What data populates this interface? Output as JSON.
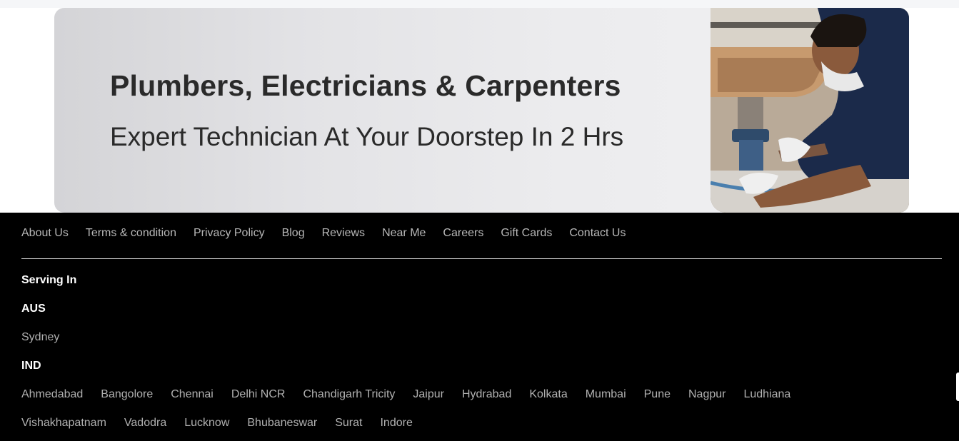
{
  "banner": {
    "title": "Plumbers, Electricians & Carpenters",
    "subtitle": "Expert Technician At Your Doorstep In 2 Hrs"
  },
  "footer": {
    "links": [
      "About Us",
      "Terms & condition",
      "Privacy Policy",
      "Blog",
      "Reviews",
      "Near Me",
      "Careers",
      "Gift Cards",
      "Contact Us"
    ],
    "serving_heading": "Serving In",
    "regions": [
      {
        "name": "AUS",
        "cities": [
          "Sydney"
        ]
      },
      {
        "name": "IND",
        "cities": [
          "Ahmedabad",
          "Bangolore",
          "Chennai",
          "Delhi NCR",
          "Chandigarh Tricity",
          "Jaipur",
          "Hydrabad",
          "Kolkata",
          "Mumbai",
          "Pune",
          "Nagpur",
          "Ludhiana",
          "Vishakhapatnam",
          "Vadodra",
          "Lucknow",
          "Bhubaneswar",
          "Surat",
          "Indore"
        ]
      }
    ]
  },
  "colors": {
    "footer_bg": "#000000",
    "link": "#b7b7b7",
    "heading": "#ffffff",
    "banner_text": "#2a2a2a",
    "uniform": "#1b2a4a"
  }
}
